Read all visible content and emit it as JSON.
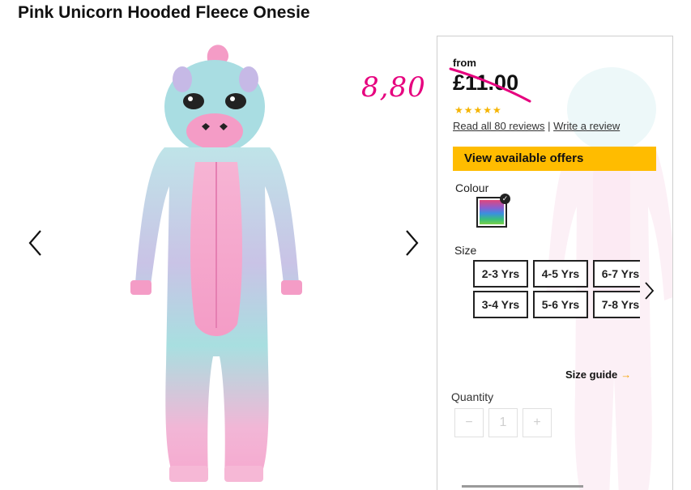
{
  "product": {
    "title": "Pink Unicorn Hooded Fleece Onesie"
  },
  "annotation": {
    "text": "8,80"
  },
  "panel": {
    "from_label": "from",
    "price": "£11.00",
    "stars": "★★★★★",
    "rating": 5,
    "reviews_link": "Read all 80 reviews",
    "separator": "|",
    "write_review_link": "Write a review",
    "offers_button": "View available offers",
    "colour_label": "Colour",
    "size_label": "Size",
    "sizes": [
      "2-3 Yrs",
      "4-5 Yrs",
      "6-7 Yrs",
      "3-4 Yrs",
      "5-6 Yrs",
      "7-8 Yrs"
    ],
    "size_guide": "Size guide",
    "size_guide_arrow": "→",
    "quantity_label": "Quantity",
    "quantity_minus": "−",
    "quantity_value": "1",
    "quantity_plus": "+"
  },
  "icons": {
    "prev": "chevron-left-icon",
    "next": "chevron-right-icon",
    "size_next": "chevron-right-icon",
    "swatch_check": "check-icon"
  },
  "colors": {
    "accent_button": "#ffbc00",
    "annotation": "#e6007e",
    "stars": "#f5b400"
  }
}
